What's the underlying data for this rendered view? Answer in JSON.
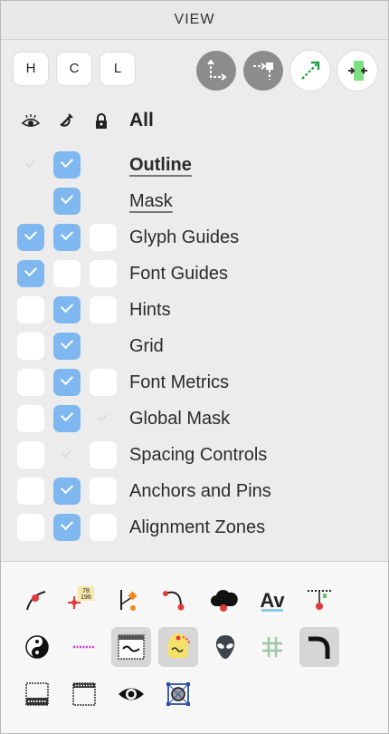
{
  "panel": {
    "title": "VIEW"
  },
  "toolbar": {
    "buttons": [
      {
        "label": "H"
      },
      {
        "label": "C"
      },
      {
        "label": "L"
      }
    ],
    "round_buttons": [
      {
        "icon": "node-direction-icon",
        "style": "dark"
      },
      {
        "icon": "node-offset-icon",
        "style": "dark"
      },
      {
        "icon": "diagonal-arrow-icon",
        "style": "light"
      },
      {
        "icon": "metrics-arrows-icon",
        "style": "light"
      }
    ]
  },
  "header": {
    "columns": [
      {
        "icon": "eye-icon"
      },
      {
        "icon": "magnet-pen-icon"
      },
      {
        "icon": "lock-icon"
      }
    ],
    "all_label": "All"
  },
  "layers": [
    {
      "label": "Outline",
      "bold": true,
      "underline": true,
      "visible": "ghost",
      "snap": "on",
      "lock": "none"
    },
    {
      "label": "Mask",
      "bold": false,
      "underline": true,
      "visible": "none",
      "snap": "on",
      "lock": "none"
    },
    {
      "label": "Glyph Guides",
      "bold": false,
      "underline": false,
      "visible": "on",
      "snap": "on",
      "lock": "off"
    },
    {
      "label": "Font Guides",
      "bold": false,
      "underline": false,
      "visible": "on",
      "snap": "off",
      "lock": "off"
    },
    {
      "label": "Hints",
      "bold": false,
      "underline": false,
      "visible": "off",
      "snap": "on",
      "lock": "off"
    },
    {
      "label": "Grid",
      "bold": false,
      "underline": false,
      "visible": "off",
      "snap": "on",
      "lock": "none"
    },
    {
      "label": "Font Metrics",
      "bold": false,
      "underline": false,
      "visible": "off",
      "snap": "on",
      "lock": "off"
    },
    {
      "label": "Global Mask",
      "bold": false,
      "underline": false,
      "visible": "off",
      "snap": "on",
      "lock": "ghost"
    },
    {
      "label": "Spacing Controls",
      "bold": false,
      "underline": false,
      "visible": "off",
      "snap": "ghost",
      "lock": "off"
    },
    {
      "label": "Anchors and Pins",
      "bold": false,
      "underline": false,
      "visible": "off",
      "snap": "on",
      "lock": "off"
    },
    {
      "label": "Alignment Zones",
      "bold": false,
      "underline": false,
      "visible": "off",
      "snap": "on",
      "lock": "off"
    }
  ],
  "tools": {
    "numbers_badge": [
      "78",
      "196"
    ],
    "kerning_text": "Av",
    "items": [
      {
        "icon": "curve-point-icon",
        "selected": false
      },
      {
        "icon": "coordinates-icon",
        "selected": false
      },
      {
        "icon": "bcp-handle-icon",
        "selected": false
      },
      {
        "icon": "curve-end-icon",
        "selected": false
      },
      {
        "icon": "cloud-icon",
        "selected": false
      },
      {
        "icon": "kerning-icon",
        "selected": false
      },
      {
        "icon": "measure-pin-icon",
        "selected": false
      },
      {
        "icon": "yin-yang-icon",
        "selected": false
      },
      {
        "icon": "dotted-line-icon",
        "selected": false
      },
      {
        "icon": "window-curve-icon",
        "selected": true
      },
      {
        "icon": "sticky-note-icon",
        "selected": true
      },
      {
        "icon": "alien-icon",
        "selected": false
      },
      {
        "icon": "hash-grid-icon",
        "selected": false
      },
      {
        "icon": "corner-curve-icon",
        "selected": true
      },
      {
        "icon": "filmstrip-bottom-icon",
        "selected": false
      },
      {
        "icon": "filmstrip-top-icon",
        "selected": false
      },
      {
        "icon": "eye-outline-icon",
        "selected": false
      },
      {
        "icon": "bounding-box-icon",
        "selected": false
      }
    ]
  }
}
